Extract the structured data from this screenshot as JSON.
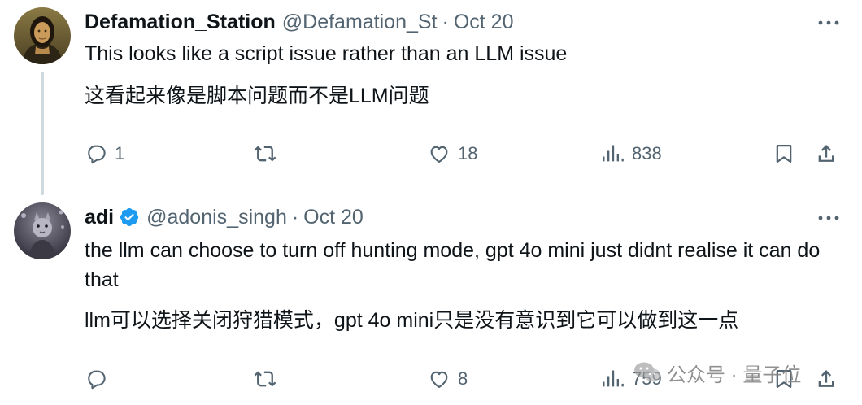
{
  "tweets": [
    {
      "display_name": "Defamation_Station",
      "handle": "@Defamation_St",
      "separator": "·",
      "date": "Oct 20",
      "verified": false,
      "text_en": "This looks like a script issue rather than an LLM issue",
      "text_zh": "这看起来像是脚本问题而不是LLM问题",
      "stats": {
        "replies": "1",
        "reposts": "",
        "likes": "18",
        "views": "838"
      }
    },
    {
      "display_name": "adi",
      "handle": "@adonis_singh",
      "separator": "·",
      "date": "Oct 20",
      "verified": true,
      "text_en": "the llm can choose to turn off hunting mode, gpt 4o mini just didnt realise it can do that",
      "text_zh": "llm可以选择关闭狩猎模式，gpt 4o mini只是没有意识到它可以做到这一点",
      "stats": {
        "replies": "",
        "reposts": "",
        "likes": "8",
        "views": "759"
      }
    }
  ],
  "watermark": {
    "text": "公众号 · 量子位"
  },
  "icons": {
    "reply": "reply-icon",
    "repost": "repost-icon",
    "like": "heart-icon",
    "views": "views-icon",
    "bookmark": "bookmark-icon",
    "share": "share-icon",
    "more": "more-icon",
    "verified": "verified-badge-icon"
  },
  "colors": {
    "text": "#0f1419",
    "secondary": "#536471",
    "verified_blue": "#1d9bf0",
    "thread_line": "#cfd9de"
  }
}
